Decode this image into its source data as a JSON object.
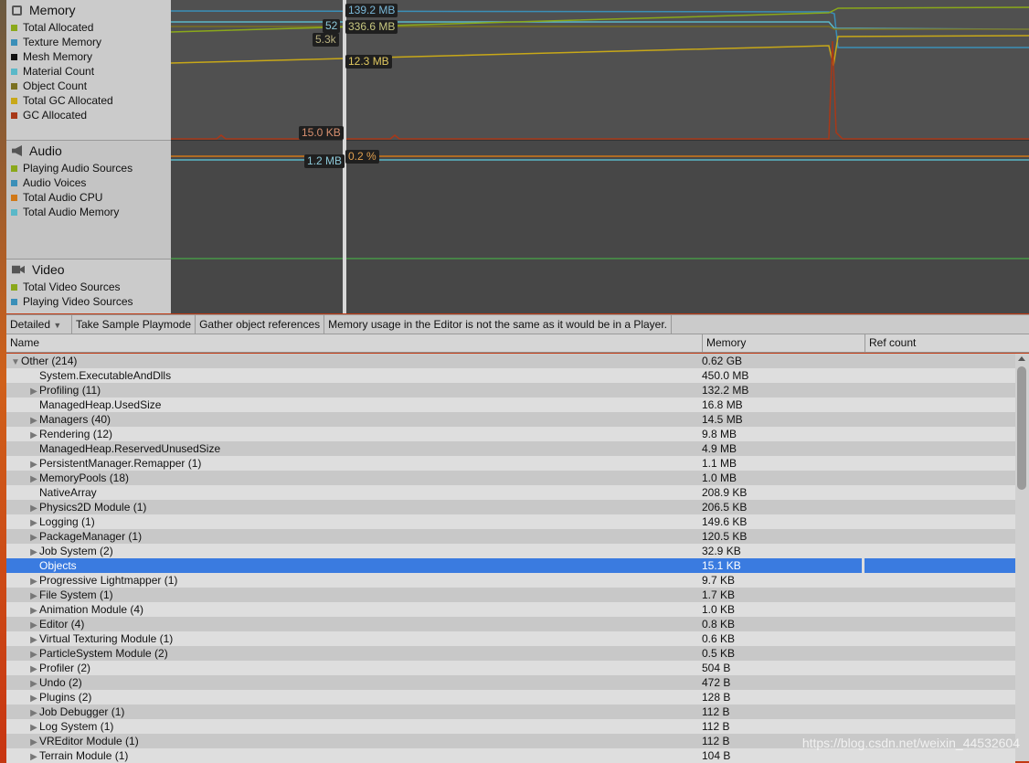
{
  "memory": {
    "title": "Memory",
    "icon": "chip-icon",
    "legend": [
      {
        "label": "Total Allocated",
        "color": "#8aa81a"
      },
      {
        "label": "Texture Memory",
        "color": "#3a8fb8"
      },
      {
        "label": "Mesh Memory",
        "color": "#111111"
      },
      {
        "label": "Material Count",
        "color": "#5ab8c8"
      },
      {
        "label": "Object Count",
        "color": "#7a7020"
      },
      {
        "label": "Total GC Allocated",
        "color": "#c8a818"
      },
      {
        "label": "GC Allocated",
        "color": "#a83818"
      }
    ],
    "labels": {
      "texture": "139.2 MB",
      "material": "52",
      "total": "336.6 MB",
      "object": "5.3k",
      "gc_total": "12.3 MB",
      "gc": "15.0 KB"
    }
  },
  "audio": {
    "title": "Audio",
    "icon": "speaker-icon",
    "legend": [
      {
        "label": "Playing Audio Sources",
        "color": "#8aa81a"
      },
      {
        "label": "Audio Voices",
        "color": "#3a8fb8"
      },
      {
        "label": "Total Audio CPU",
        "color": "#d07818"
      },
      {
        "label": "Total Audio Memory",
        "color": "#5ab8c8"
      }
    ],
    "labels": {
      "memory": "1.2 MB",
      "cpu": "0.2 %"
    }
  },
  "video": {
    "title": "Video",
    "icon": "camera-icon",
    "legend": [
      {
        "label": "Total Video Sources",
        "color": "#8aa81a"
      },
      {
        "label": "Playing Video Sources",
        "color": "#3a8fb8"
      }
    ]
  },
  "toolbar": {
    "mode": "Detailed",
    "take_sample": "Take Sample Playmode",
    "gather": "Gather object references",
    "notice": "Memory usage in the Editor is not the same as it would be in a Player."
  },
  "table": {
    "headers": [
      "Name",
      "Memory",
      "Ref count"
    ],
    "rows": [
      {
        "name": "Other (214)",
        "memory": "0.62 GB",
        "expand": "open",
        "level": 0
      },
      {
        "name": "System.ExecutableAndDlls",
        "memory": "450.0 MB",
        "expand": "none",
        "level": 1
      },
      {
        "name": "Profiling (11)",
        "memory": "132.2 MB",
        "expand": "closed",
        "level": 1
      },
      {
        "name": "ManagedHeap.UsedSize",
        "memory": "16.8 MB",
        "expand": "none",
        "level": 1
      },
      {
        "name": "Managers (40)",
        "memory": "14.5 MB",
        "expand": "closed",
        "level": 1
      },
      {
        "name": "Rendering (12)",
        "memory": "9.8 MB",
        "expand": "closed",
        "level": 1
      },
      {
        "name": "ManagedHeap.ReservedUnusedSize",
        "memory": "4.9 MB",
        "expand": "none",
        "level": 1
      },
      {
        "name": "PersistentManager.Remapper (1)",
        "memory": "1.1 MB",
        "expand": "closed",
        "level": 1
      },
      {
        "name": "MemoryPools (18)",
        "memory": "1.0 MB",
        "expand": "closed",
        "level": 1
      },
      {
        "name": "NativeArray",
        "memory": "208.9 KB",
        "expand": "none",
        "level": 1
      },
      {
        "name": "Physics2D Module (1)",
        "memory": "206.5 KB",
        "expand": "closed",
        "level": 1
      },
      {
        "name": "Logging (1)",
        "memory": "149.6 KB",
        "expand": "closed",
        "level": 1
      },
      {
        "name": "PackageManager (1)",
        "memory": "120.5 KB",
        "expand": "closed",
        "level": 1
      },
      {
        "name": "Job System (2)",
        "memory": "32.9 KB",
        "expand": "closed",
        "level": 1
      },
      {
        "name": "Objects",
        "memory": "15.1 KB",
        "expand": "none",
        "level": 1,
        "selected": true
      },
      {
        "name": "Progressive Lightmapper (1)",
        "memory": "9.7 KB",
        "expand": "closed",
        "level": 1
      },
      {
        "name": "File System (1)",
        "memory": "1.7 KB",
        "expand": "closed",
        "level": 1
      },
      {
        "name": "Animation Module (4)",
        "memory": "1.0 KB",
        "expand": "closed",
        "level": 1
      },
      {
        "name": "Editor (4)",
        "memory": "0.8 KB",
        "expand": "closed",
        "level": 1
      },
      {
        "name": "Virtual Texturing Module (1)",
        "memory": "0.6 KB",
        "expand": "closed",
        "level": 1
      },
      {
        "name": "ParticleSystem Module (2)",
        "memory": "0.5 KB",
        "expand": "closed",
        "level": 1
      },
      {
        "name": "Profiler (2)",
        "memory": "504 B",
        "expand": "closed",
        "level": 1
      },
      {
        "name": "Undo (2)",
        "memory": "472 B",
        "expand": "closed",
        "level": 1
      },
      {
        "name": "Plugins (2)",
        "memory": "128 B",
        "expand": "closed",
        "level": 1
      },
      {
        "name": "Job Debugger (1)",
        "memory": "112 B",
        "expand": "closed",
        "level": 1
      },
      {
        "name": "Log System (1)",
        "memory": "112 B",
        "expand": "closed",
        "level": 1
      },
      {
        "name": "VREditor Module (1)",
        "memory": "112 B",
        "expand": "closed",
        "level": 1
      },
      {
        "name": "Terrain Module (1)",
        "memory": "104 B",
        "expand": "closed",
        "level": 1
      }
    ]
  },
  "watermark": "https://blog.csdn.net/weixin_44532604"
}
